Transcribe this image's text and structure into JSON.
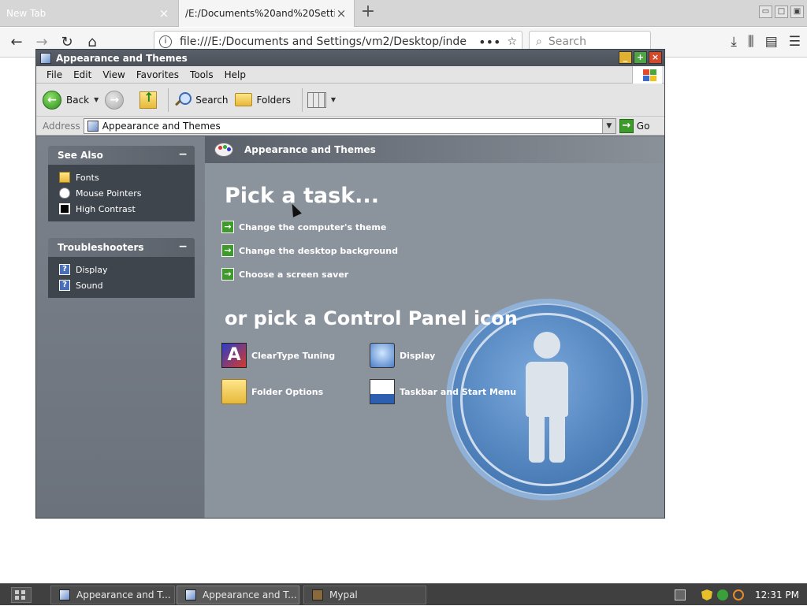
{
  "browser": {
    "tabs": [
      {
        "title": "New Tab",
        "close": "×"
      },
      {
        "title": "/E:/Documents%20and%20Setti",
        "close": "×"
      }
    ],
    "new_tab": "+",
    "window_buttons": [
      "▭",
      "□",
      "▣"
    ],
    "url": "file:///E:/Documents and Settings/vm2/Desktop/inde",
    "url_more": "•••",
    "search_placeholder": "Search",
    "nav": {
      "back": "←",
      "forward": "→",
      "reload": "↻",
      "home": "⌂"
    },
    "right_icons": {
      "downloads": "⤓",
      "library": "⫼",
      "sidebar": "▤",
      "menu": "☰"
    }
  },
  "window": {
    "title": "Appearance and Themes",
    "title_buttons": [
      "_",
      "+",
      "×"
    ],
    "menu": [
      "File",
      "Edit",
      "View",
      "Favorites",
      "Tools",
      "Help"
    ],
    "toolbar": {
      "back": "Back",
      "search": "Search",
      "folders": "Folders"
    },
    "address": {
      "label": "Address",
      "value": "Appearance and Themes",
      "go": "Go"
    }
  },
  "sidebar": {
    "see_also": {
      "title": "See Also",
      "collapse": "−",
      "items": [
        "Fonts",
        "Mouse Pointers",
        "High Contrast"
      ]
    },
    "troubleshooters": {
      "title": "Troubleshooters",
      "collapse": "−",
      "items": [
        "Display",
        "Sound"
      ]
    }
  },
  "main": {
    "header": "Appearance and Themes",
    "pick_task": "Pick a task...",
    "tasks": [
      "Change the computer's theme",
      "Change the desktop background",
      "Choose a screen saver"
    ],
    "or_pick": "or pick a Control Panel icon",
    "icons": [
      "ClearType Tuning",
      "Display",
      "Folder Options",
      "Taskbar and Start Menu"
    ]
  },
  "taskbar": {
    "tasks": [
      "Appearance and T...",
      "Appearance and T...",
      "Mypal"
    ],
    "clock": "12:31 PM"
  },
  "colors": {
    "window_frame": "#5f6670",
    "content_bg": "#8b939d",
    "panel_body": "#3f454d",
    "accent_green": "#3f9a2c",
    "taskbar": "#404040"
  }
}
